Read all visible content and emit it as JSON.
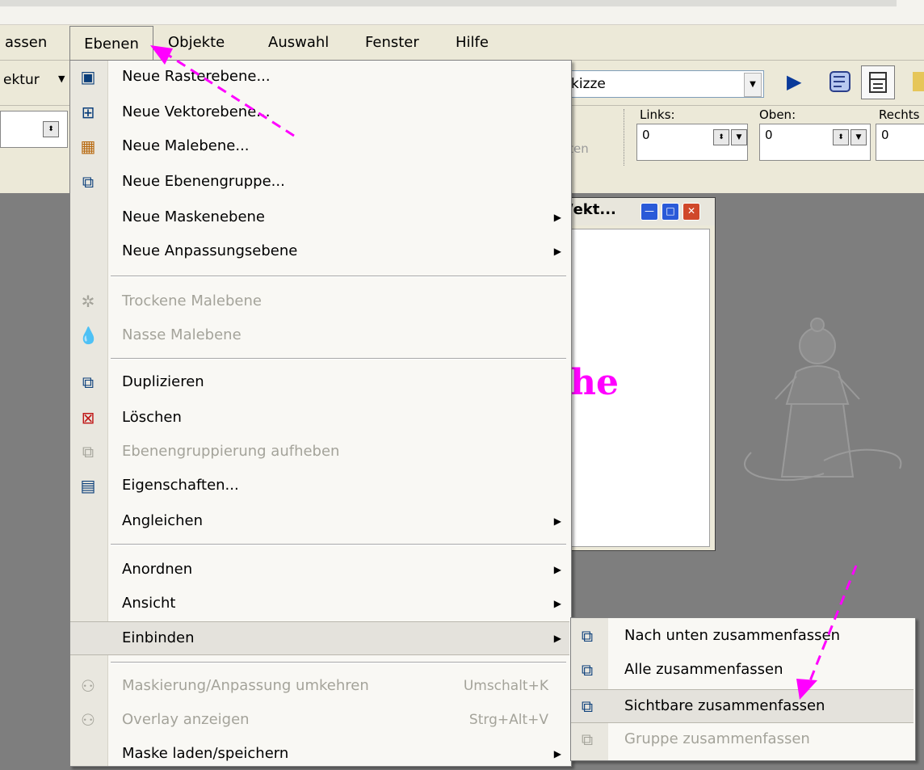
{
  "menubar": {
    "items": [
      "assen",
      "Ebenen",
      "Objekte",
      "Auswahl",
      "Fenster",
      "Hilfe"
    ]
  },
  "toolbar1": {
    "left_dropdown": "ektur",
    "preset_dropdown": "kizze"
  },
  "toolbar2": {
    "partial_label": "lten",
    "left_label": "Links:",
    "left_value": "0",
    "top_label": "Oben:",
    "top_value": "0",
    "right_label": "Rechts",
    "right_value": "0"
  },
  "layer_window": {
    "title": "/ekt...",
    "canvas_text": "he"
  },
  "menu": {
    "items": [
      {
        "label": "Neue Rasterebene...",
        "icon": "raster-layer-icon",
        "enabled": true,
        "submenu": false
      },
      {
        "label": "Neue Vektorebene...",
        "icon": "vector-layer-icon",
        "enabled": true,
        "submenu": false
      },
      {
        "label": "Neue Malebene...",
        "icon": "paint-layer-icon",
        "enabled": true,
        "submenu": false
      },
      {
        "label": "Neue Ebenengruppe...",
        "icon": "layer-group-icon",
        "enabled": true,
        "submenu": false
      },
      {
        "label": "Neue Maskenebene",
        "icon": "",
        "enabled": true,
        "submenu": true
      },
      {
        "label": "Neue Anpassungsebene",
        "icon": "",
        "enabled": true,
        "submenu": true
      },
      {
        "label": "Trockene Malebene",
        "icon": "dry-layer-icon",
        "enabled": false,
        "submenu": false
      },
      {
        "label": "Nasse Malebene",
        "icon": "wet-layer-icon",
        "enabled": false,
        "submenu": false
      },
      {
        "label": "Duplizieren",
        "icon": "duplicate-icon",
        "enabled": true,
        "submenu": false
      },
      {
        "label": "Löschen",
        "icon": "delete-layer-icon",
        "enabled": true,
        "submenu": false
      },
      {
        "label": "Ebenengruppierung aufheben",
        "icon": "ungroup-icon",
        "enabled": false,
        "submenu": false
      },
      {
        "label": "Eigenschaften...",
        "icon": "properties-icon",
        "enabled": true,
        "submenu": false
      },
      {
        "label": "Angleichen",
        "icon": "",
        "enabled": true,
        "submenu": true
      },
      {
        "label": "Anordnen",
        "icon": "",
        "enabled": true,
        "submenu": true
      },
      {
        "label": "Ansicht",
        "icon": "",
        "enabled": true,
        "submenu": true
      },
      {
        "label": "Einbinden",
        "icon": "",
        "enabled": true,
        "submenu": true,
        "highlighted": true
      },
      {
        "label": "Maskierung/Anpassung umkehren",
        "shortcut": "Umschalt+K",
        "icon": "invert-mask-icon",
        "enabled": false,
        "submenu": false
      },
      {
        "label": "Overlay anzeigen",
        "shortcut": "Strg+Alt+V",
        "icon": "overlay-icon",
        "enabled": false,
        "submenu": false
      },
      {
        "label": "Maske laden/speichern",
        "icon": "",
        "enabled": true,
        "submenu": true
      }
    ]
  },
  "submenu": {
    "items": [
      {
        "label": "Nach unten zusammenfassen",
        "icon": "merge-down-icon",
        "enabled": true
      },
      {
        "label": "Alle zusammenfassen",
        "icon": "merge-all-icon",
        "enabled": true
      },
      {
        "label": "Sichtbare zusammenfassen",
        "icon": "merge-visible-icon",
        "enabled": true,
        "highlighted": true
      },
      {
        "label": "Gruppe zusammenfassen",
        "icon": "merge-group-icon",
        "enabled": false
      }
    ]
  },
  "colors": {
    "annotation_arrow": "#ff00ff",
    "canvas_text": "#ff00ff",
    "menu_background": "#f9f8f4",
    "workspace": "#7e7e7e"
  }
}
